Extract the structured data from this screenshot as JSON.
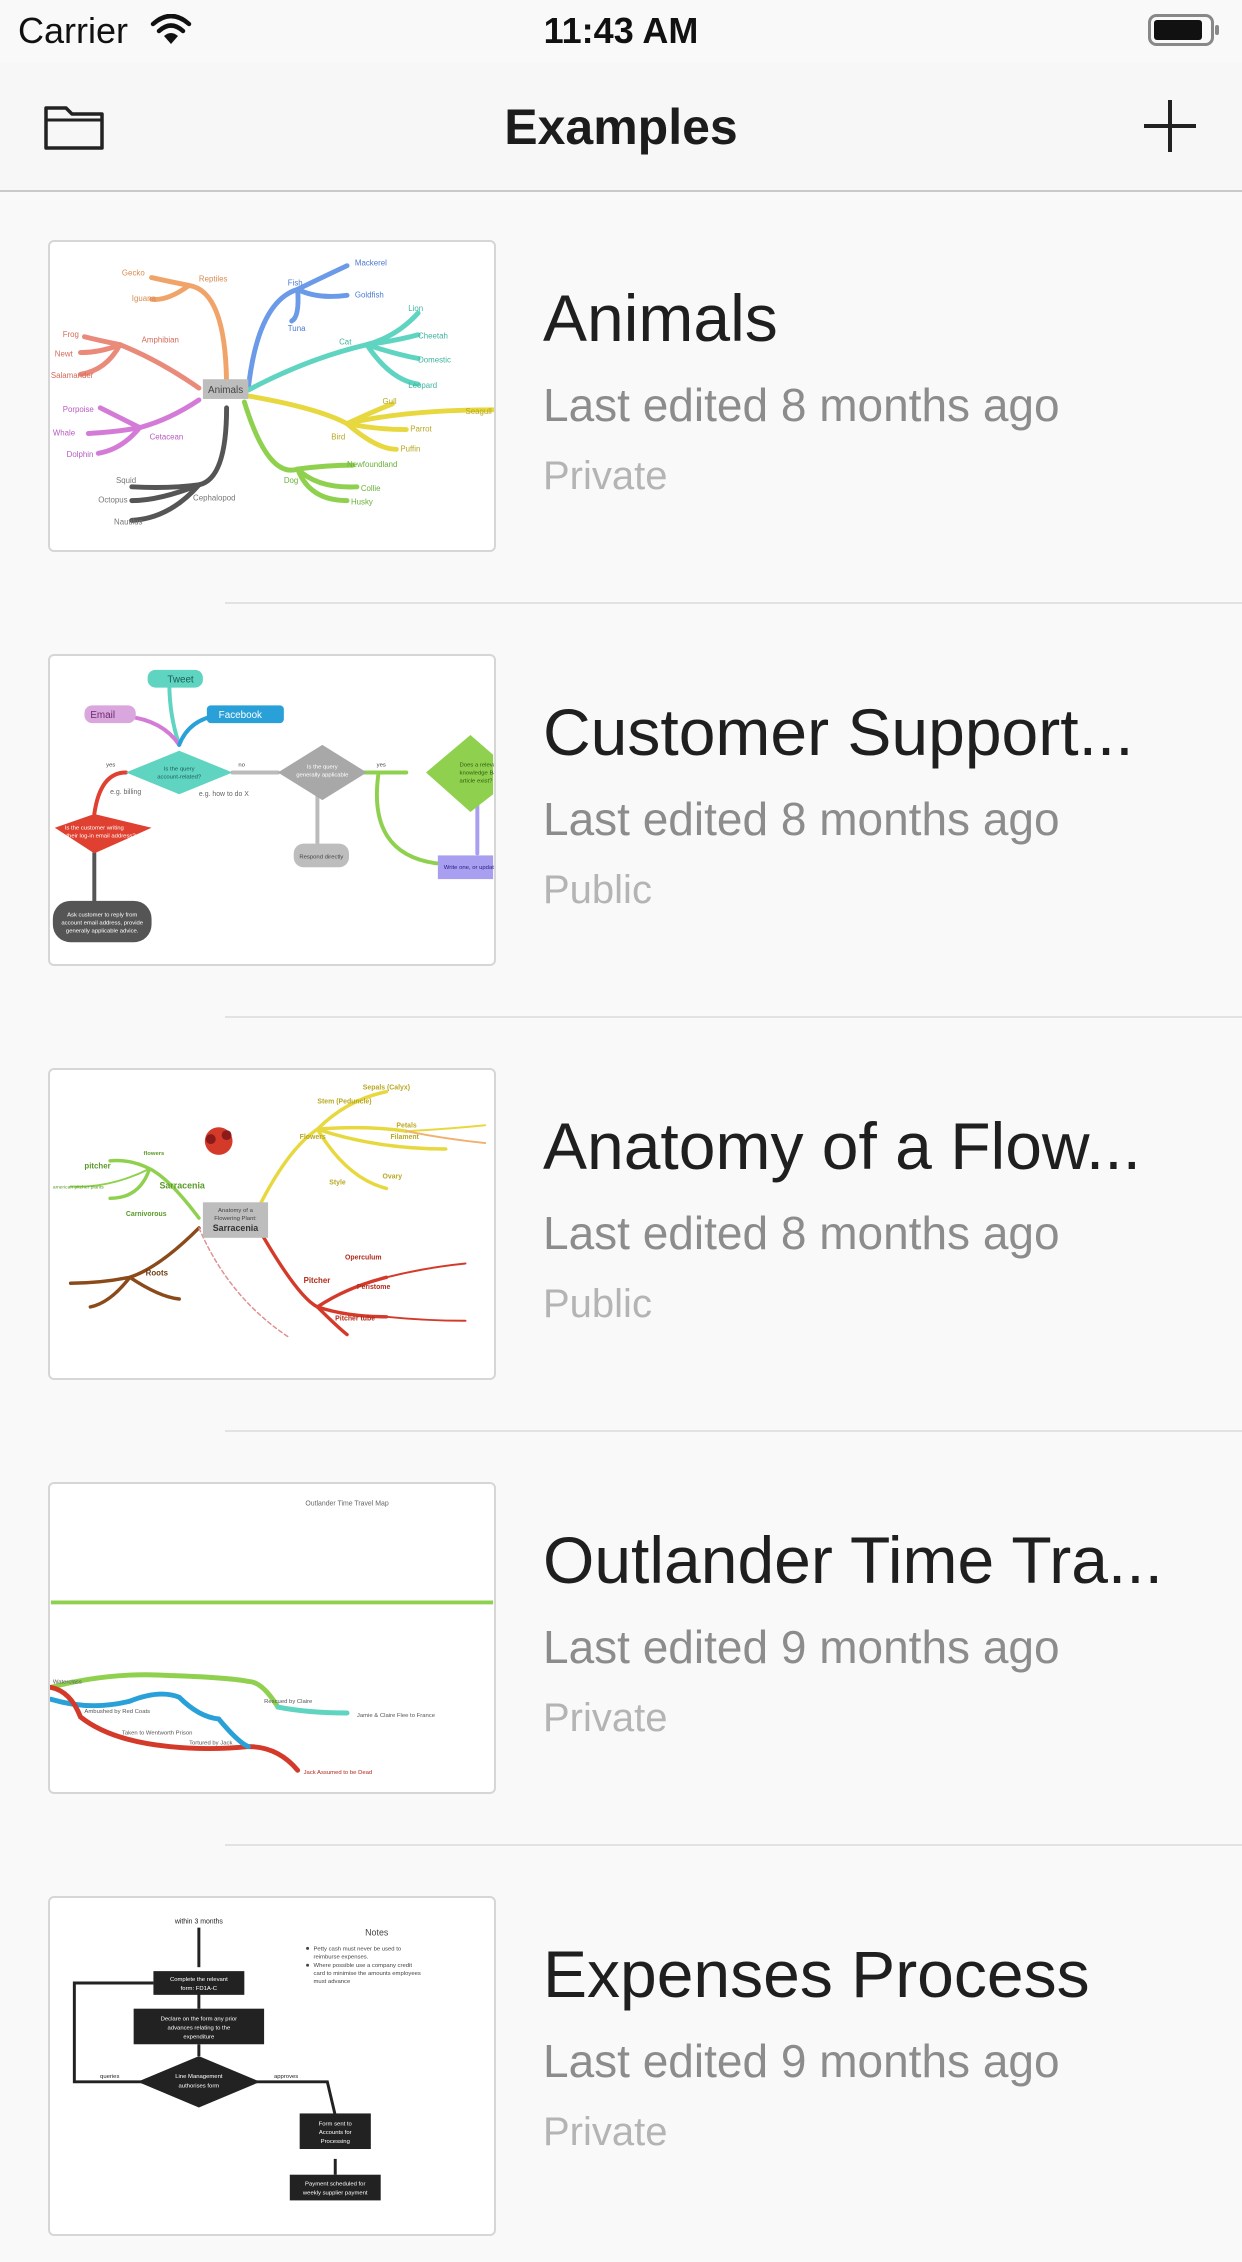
{
  "status_bar": {
    "carrier": "Carrier",
    "time": "11:43 AM"
  },
  "nav": {
    "title": "Examples"
  },
  "items": [
    {
      "title": "Animals",
      "edited": "Last edited 8 months ago",
      "visibility": "Private"
    },
    {
      "title": "Customer Support...",
      "edited": "Last edited 8 months ago",
      "visibility": "Public"
    },
    {
      "title": "Anatomy of a Flow...",
      "edited": "Last edited 8 months ago",
      "visibility": "Public"
    },
    {
      "title": "Outlander Time Tra...",
      "edited": "Last edited 9 months ago",
      "visibility": "Private"
    },
    {
      "title": "Expenses Process",
      "edited": "Last edited 9 months ago",
      "visibility": "Private"
    }
  ],
  "thumbnails": {
    "animals": {
      "center": "Animals",
      "labels": [
        "Gecko",
        "Reptiles",
        "Iguana",
        "Frog",
        "Newt",
        "Salamander",
        "Amphibian",
        "Porpoise",
        "Whale",
        "Dolphin",
        "Cetacean",
        "Squid",
        "Octopus",
        "Nautilus",
        "Cephalopod",
        "Fish",
        "Mackerel",
        "Goldfish",
        "Tuna",
        "Cat",
        "Lion",
        "Cheetah",
        "Domestic",
        "Leopard",
        "Bird",
        "Gull",
        "Parrot",
        "Puffin",
        "Seagull",
        "Dog",
        "Newfoundland",
        "Collie",
        "Husky"
      ]
    },
    "support": {
      "labels": [
        "Tweet",
        "Email",
        "Facebook",
        "Is the query account-related?",
        "e.g. billing",
        "e.g. how to do X",
        "Is the query generally applicable",
        "Does a relevant knowledge Base article exist?",
        "Is the customer writing from their log-in email address?",
        "Respond directly",
        "Write one, or update existing article",
        "Ask customer to reply from account email address, provide generally applicable advice if appropriate.",
        "yes",
        "no"
      ]
    },
    "flower": {
      "center": "Anatomy of a Flowering Plant: Sarracenia",
      "labels": [
        "Flowers",
        "Sarracenia",
        "Carnivorous",
        "pitcher",
        "Roots",
        "Pitcher",
        "Stem (Peduncle)",
        "Sepals (Calyx)",
        "Petals",
        "Filament",
        "Ovary",
        "Style",
        "Operculum",
        "Peristome",
        "Pitcher tube",
        "american pitcher plants",
        "flowers"
      ]
    },
    "outlander": {
      "title": "Outlander Time Travel Map",
      "labels": [
        "Waterclass",
        "Ambushed by Red Coats",
        "Taken to Wentworth Prison",
        "Tortured by Jack",
        "Rescued by Claire",
        "Jamie & Claire Flee to France",
        "Jack Assumed to be Dead"
      ]
    },
    "expenses": {
      "labels": [
        "within 3 months",
        "Complete the relevant form: FD1A-C",
        "Declare on the form any prior advances relating to the expenditure",
        "Line Management authorises form",
        "queries",
        "approves",
        "Form sent to Accounts for Processing",
        "Payment scheduled for weekly supplier payment",
        "Notes",
        "Petty cash must never be used to reimburse expenses.",
        "Where possible use a company credit card to minimise the amounts employees must advance"
      ]
    }
  }
}
